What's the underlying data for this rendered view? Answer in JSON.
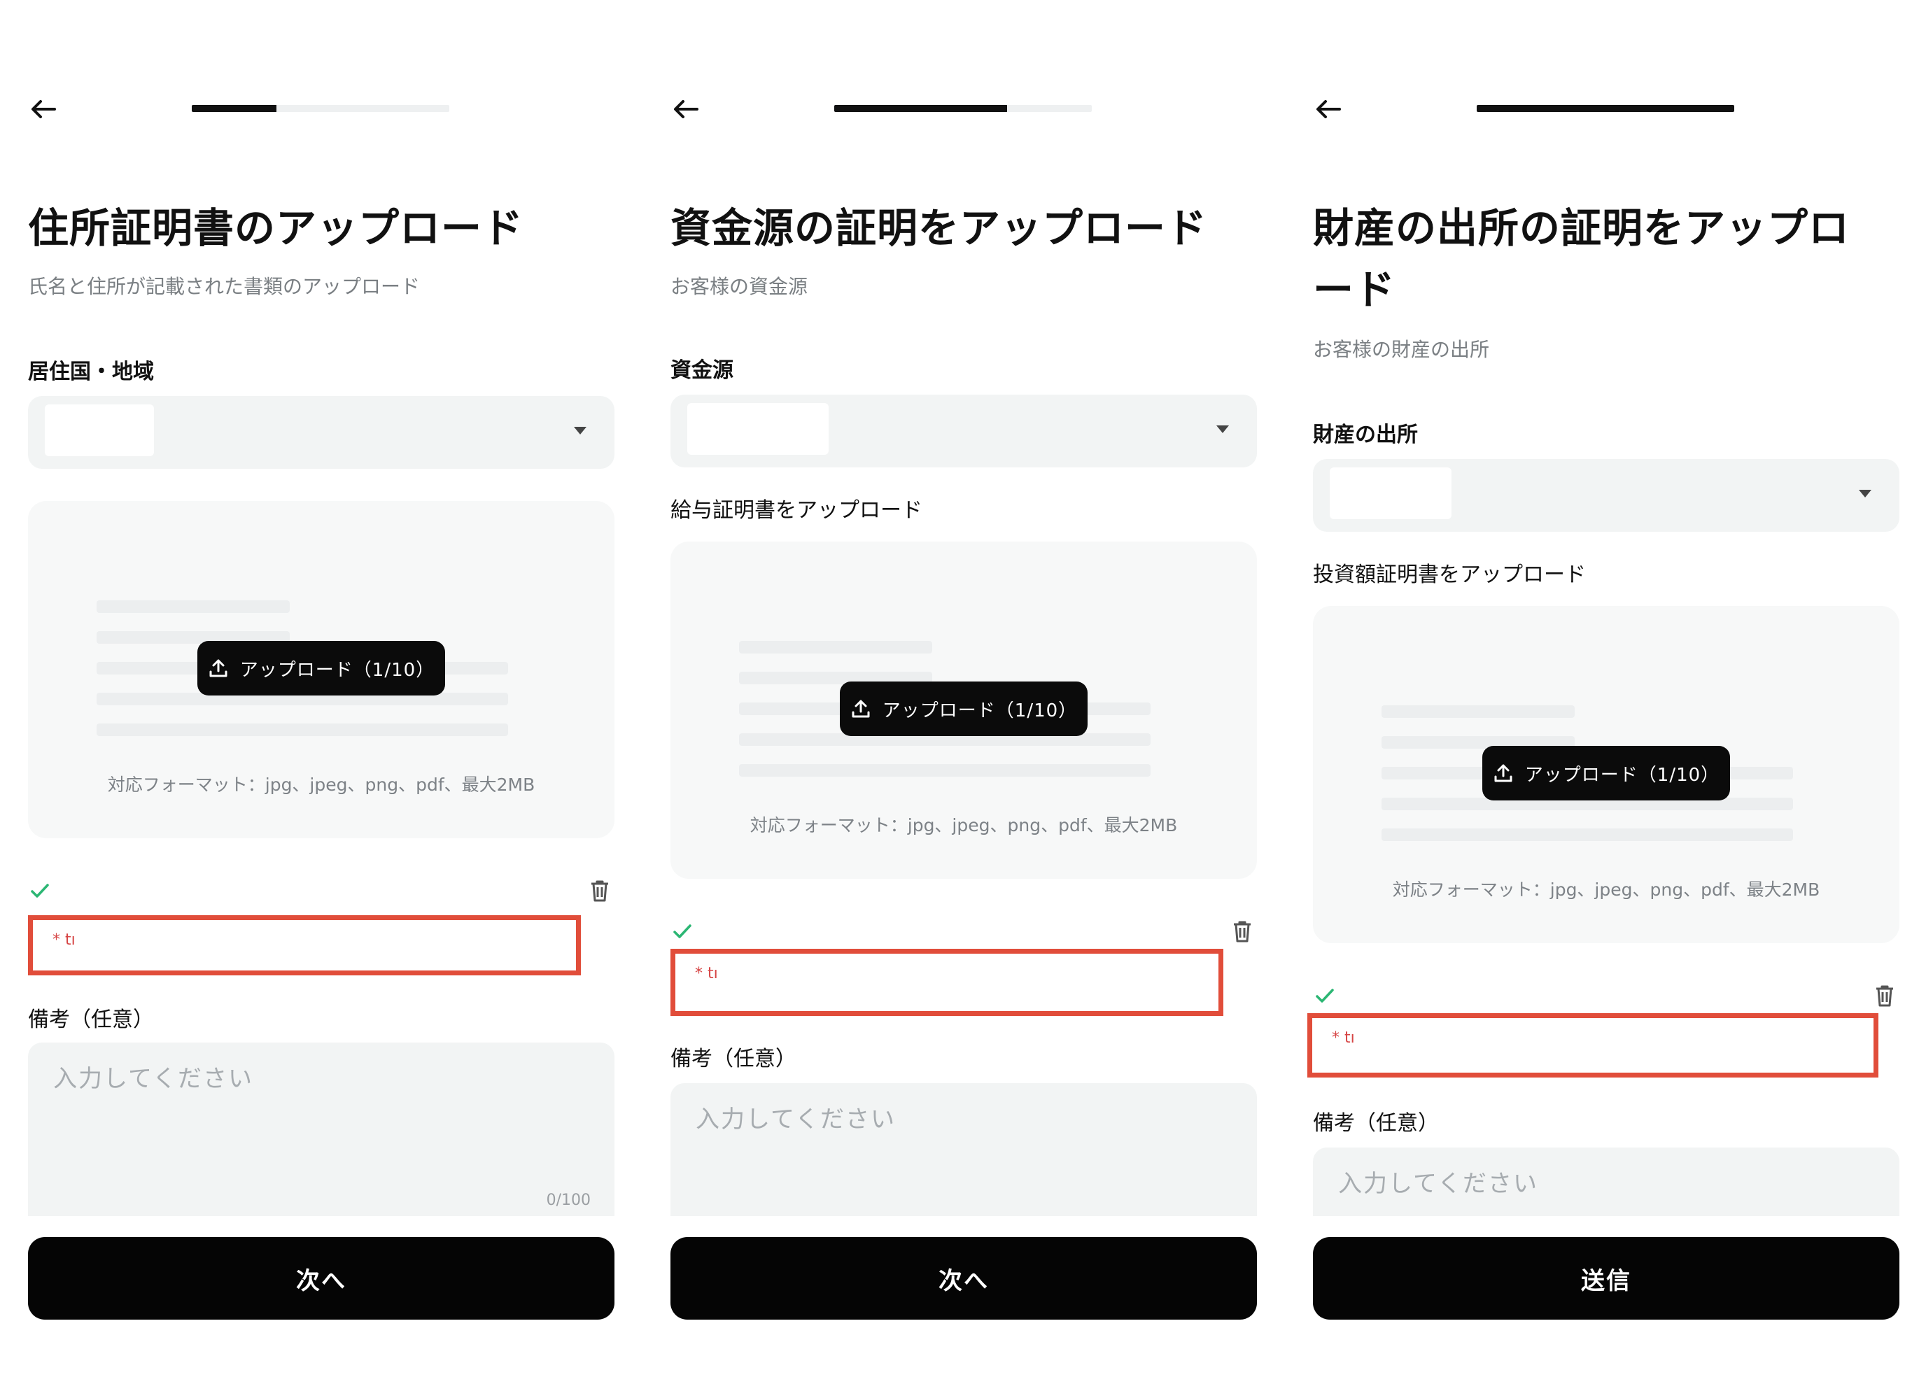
{
  "screens": [
    {
      "progress": 0.33,
      "title": "住所証明書のアップロード",
      "subtitle": "氏名と住所が記載された書類のアップロード",
      "select_label": "居住国・地域",
      "upload_label": "",
      "upload_button": "アップロード（1/10）",
      "format_text": "対応フォーマット：jpg、jpeg、png、pdf、最大2MB",
      "file_name": "* tı",
      "memo_label": "備考（任意）",
      "memo_placeholder": "入力してください",
      "memo_counter": "0/100",
      "primary_button": "次へ"
    },
    {
      "progress": 0.67,
      "title": "資金源の証明をアップロード",
      "subtitle": "お客様の資金源",
      "select_label": "資金源",
      "upload_label": "給与証明書をアップロード",
      "upload_button": "アップロード（1/10）",
      "format_text": "対応フォーマット：jpg、jpeg、png、pdf、最大2MB",
      "file_name": "* tı",
      "memo_label": "備考（任意）",
      "memo_placeholder": "入力してください",
      "memo_counter": "",
      "primary_button": "次へ"
    },
    {
      "progress": 1.0,
      "title": "財産の出所の証明をアップロード",
      "subtitle": "お客様の財産の出所",
      "select_label": "財産の出所",
      "upload_label": "投資額証明書をアップロード",
      "upload_button": "アップロード（1/10）",
      "format_text": "対応フォーマット：jpg、jpeg、png、pdf、最大2MB",
      "file_name": "* tı",
      "memo_label": "備考（任意）",
      "memo_placeholder": "入力してください",
      "memo_counter": "",
      "primary_button": "送信"
    }
  ],
  "colors": {
    "accent": "#0b0b0b",
    "error_border": "#e14d3a",
    "success_check": "#2bb673",
    "input_bg": "#f2f4f4"
  },
  "icons": [
    "back-arrow-icon",
    "chevron-down-icon",
    "upload-icon",
    "check-icon",
    "trash-icon"
  ]
}
